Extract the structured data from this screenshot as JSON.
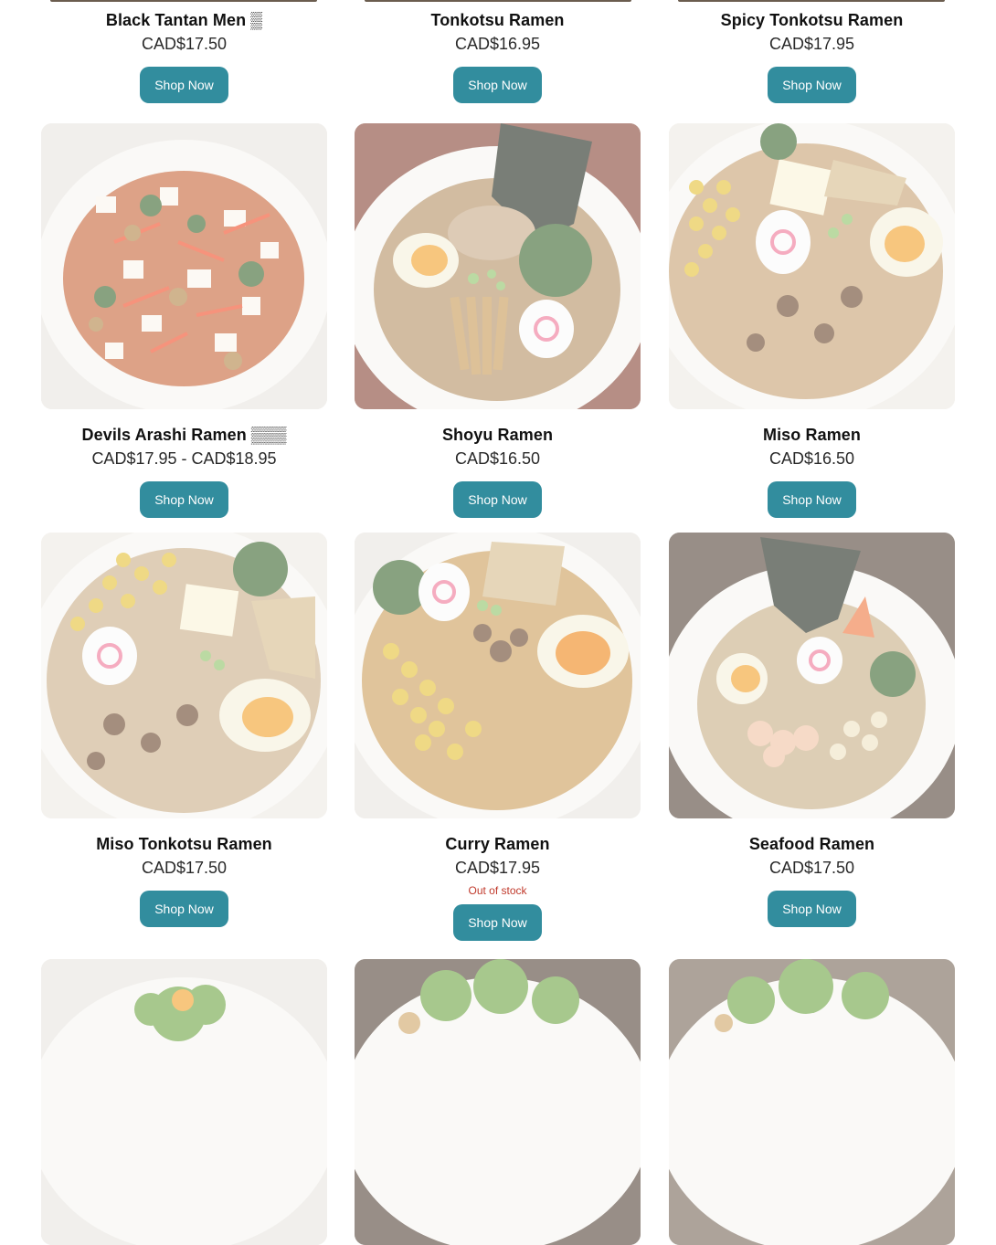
{
  "products_row0": [
    {
      "name": "Black Tantan Men",
      "glyph": "▒",
      "price": "CAD$17.50",
      "button": "Shop Now"
    },
    {
      "name": "Tonkotsu Ramen",
      "glyph": "",
      "price": "CAD$16.95",
      "button": "Shop Now"
    },
    {
      "name": "Spicy Tonkotsu Ramen",
      "glyph": "",
      "price": "CAD$17.95",
      "button": "Shop Now"
    }
  ],
  "products_row1": [
    {
      "name": "Devils Arashi Ramen",
      "glyph": "▒▒▒",
      "price": "CAD$17.95 - CAD$18.95",
      "button": "Shop Now",
      "image": "spicy-tofu-ramen-bowl"
    },
    {
      "name": "Shoyu Ramen",
      "glyph": "",
      "price": "CAD$16.50",
      "button": "Shop Now",
      "image": "shoyu-ramen-bowl"
    },
    {
      "name": "Miso Ramen",
      "glyph": "",
      "price": "CAD$16.50",
      "button": "Shop Now",
      "image": "miso-ramen-bowl"
    }
  ],
  "products_row2": [
    {
      "name": "Miso Tonkotsu Ramen",
      "glyph": "",
      "price": "CAD$17.50",
      "button": "Shop Now",
      "image": "miso-tonkotsu-ramen-bowl"
    },
    {
      "name": "Curry Ramen",
      "glyph": "",
      "price": "CAD$17.95",
      "stock": "Out of stock",
      "button": "Shop Now",
      "image": "curry-ramen-bowl"
    },
    {
      "name": "Seafood Ramen",
      "glyph": "",
      "price": "CAD$17.50",
      "button": "Shop Now",
      "image": "seafood-ramen-bowl"
    }
  ],
  "products_row3": [
    {
      "image": "salad-bowl-with-egg"
    },
    {
      "image": "green-salad-bowl"
    },
    {
      "image": "mixed-greens-salad-bowl"
    }
  ],
  "colors": {
    "button": "#328d9e",
    "out_of_stock": "#c0392b"
  }
}
